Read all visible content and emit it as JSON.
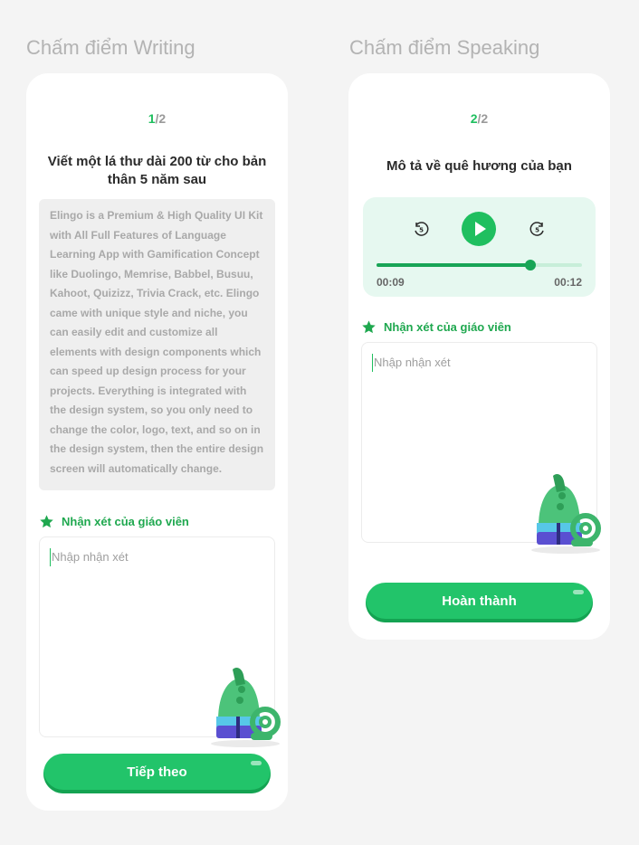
{
  "writing": {
    "section_title": "Chấm điểm Writing",
    "step_current": "1",
    "step_total": "/2",
    "question": "Viết một lá thư dài 200 từ cho bản thân 5 năm sau",
    "essay_text": "Elingo is a Premium & High Quality UI Kit with All Full Features of Language Learning App with Gamification Concept like Duolingo, Memrise, Babbel, Busuu, Kahoot, Quizizz, Trivia Crack, etc. Elingo came with unique style and niche, you can easily edit and customize all elements with design components which can speed up design process for your projects. Everything is integrated with the design system, so you only need to change the color, logo, text, and so on in the design system, then the entire design screen will automatically change.",
    "comment_label": "Nhận xét của giáo viên",
    "comment_placeholder": "Nhập nhận xét",
    "button_label": "Tiếp theo"
  },
  "speaking": {
    "section_title": "Chấm điểm Speaking",
    "step_current": "2",
    "step_total": "/2",
    "question": "Mô tả về quê hương của bạn",
    "player": {
      "rewind_seconds": "5",
      "forward_seconds": "5",
      "current_time": "00:09",
      "total_time": "00:12",
      "progress": 0.75
    },
    "comment_label": "Nhận xét của giáo viên",
    "comment_placeholder": "Nhập nhận xét",
    "button_label": "Hoàn thành"
  },
  "colors": {
    "accent": "#1fbf5f",
    "accent_dark": "#18a556",
    "player_bg": "#e6f8f0",
    "essay_bg": "#efefef"
  },
  "icons": [
    "star-icon",
    "rewind-5-icon",
    "play-icon",
    "forward-5-icon",
    "mascot-illustration"
  ]
}
